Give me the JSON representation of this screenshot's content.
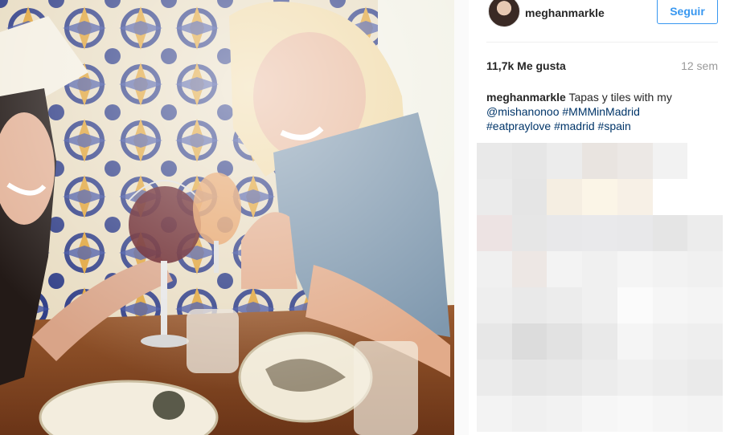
{
  "post": {
    "username": "meghanmarkle",
    "follow_label": "Seguir",
    "likes": "11,7k Me gusta",
    "time_ago": "12 sem",
    "caption": {
      "user": "meghanmarkle",
      "text": "Tapas y tiles with my",
      "mention": "@mishanonoo",
      "tags": [
        "#MMMinMadrid",
        "#eatpraylove",
        "#madrid",
        "#spain"
      ]
    }
  },
  "colors": {
    "accent": "#3897f0",
    "hashtag": "#003569",
    "muted": "#999999",
    "text": "#262626"
  },
  "blur_cells": [
    "#e9e9e9",
    "#e6e6e6",
    "#ececec",
    "#e9e4e0",
    "#ece8e5",
    "#f2f2f2",
    "#ffffff",
    "#ebebeb",
    "#e5e5e5",
    "#f5eee2",
    "#fbf5e7",
    "#f7f0e6",
    "#ffffff",
    "#ffffff",
    "#ede3e3",
    "#e6e6e6",
    "#e8e8ea",
    "#e9e9eb",
    "#e8e8ea",
    "#e5e5e5",
    "#ececec",
    "#f0f0f0",
    "#ede7e4",
    "#f3f3f3",
    "#f0f0f0",
    "#f5f5f5",
    "#f2f2f2",
    "#f0f0f0",
    "#eeeeee",
    "#e9e9e9",
    "#ececec",
    "#f0f0f0",
    "#fbfbfb",
    "#f6f6f6",
    "#f4f4f4",
    "#e7e7e7",
    "#dcdcdc",
    "#e2e2e2",
    "#e9e9e9",
    "#f5f5f5",
    "#f0f0f0",
    "#eeeeee",
    "#ebebeb",
    "#e6e6e6",
    "#e8e8e8",
    "#ececec",
    "#f0f0f0",
    "#ededed",
    "#eaeaea",
    "#f3f3f3",
    "#f0f0f0",
    "#f2f2f2",
    "#f6f6f6",
    "#f8f8f8",
    "#f5f5f5",
    "#f3f3f3"
  ]
}
